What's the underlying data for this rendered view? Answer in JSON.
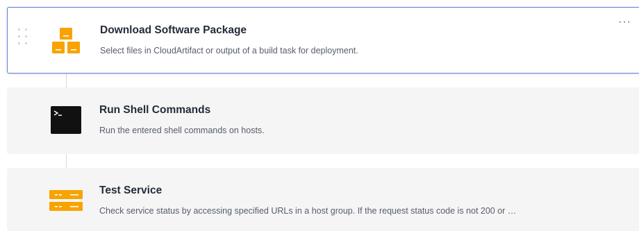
{
  "steps": [
    {
      "title": "Download Software Package",
      "description": "Select files in CloudArtifact or output of a build task for deployment.",
      "icon": "package-boxes-icon",
      "selected": true,
      "more_label": "···"
    },
    {
      "title": "Run Shell Commands",
      "description": "Run the entered shell commands on hosts.",
      "icon": "terminal-icon",
      "selected": false
    },
    {
      "title": "Test Service",
      "description": "Check service status by accessing specified URLs in a host group. If the request status code is not 200 or …",
      "icon": "server-icon",
      "selected": false
    }
  ],
  "colors": {
    "accent_border": "#5e7ce0",
    "icon_orange": "#f8a300",
    "terminal_bg": "#111111",
    "card_bg": "#f5f5f5"
  }
}
